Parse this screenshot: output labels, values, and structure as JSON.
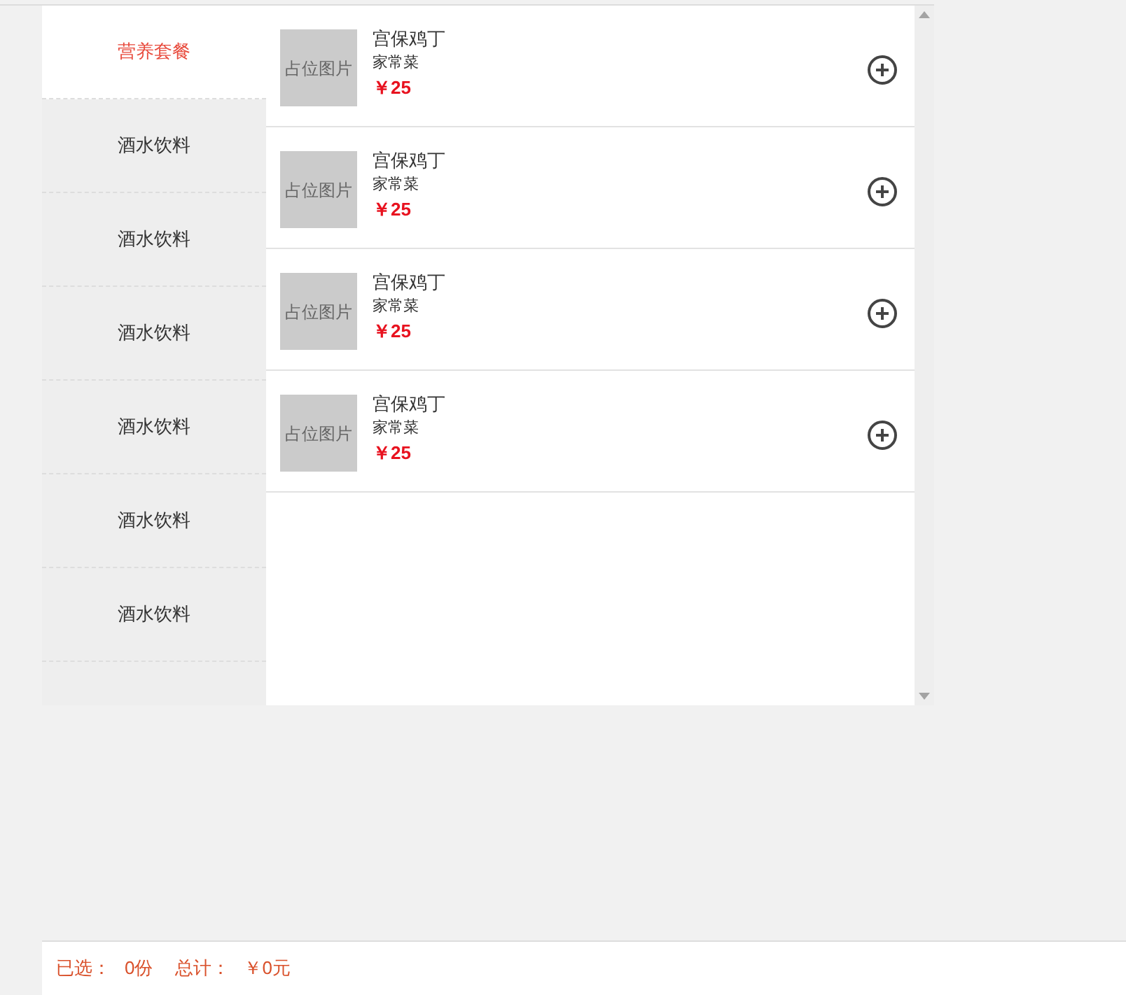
{
  "categories": [
    {
      "label": "营养套餐",
      "selected": true
    },
    {
      "label": "酒水饮料",
      "selected": false
    },
    {
      "label": "酒水饮料",
      "selected": false
    },
    {
      "label": "酒水饮料",
      "selected": false
    },
    {
      "label": "酒水饮料",
      "selected": false
    },
    {
      "label": "酒水饮料",
      "selected": false
    },
    {
      "label": "酒水饮料",
      "selected": false
    }
  ],
  "dishes": [
    {
      "image_label": "占位图片",
      "name": "宫保鸡丁",
      "category": "家常菜",
      "price": "￥25"
    },
    {
      "image_label": "占位图片",
      "name": "宫保鸡丁",
      "category": "家常菜",
      "price": "￥25"
    },
    {
      "image_label": "占位图片",
      "name": "宫保鸡丁",
      "category": "家常菜",
      "price": "￥25"
    },
    {
      "image_label": "占位图片",
      "name": "宫保鸡丁",
      "category": "家常菜",
      "price": "￥25"
    }
  ],
  "footer": {
    "selected_label": "已选：",
    "selected_count": "0份",
    "total_label": "总计：",
    "total_value": "￥0元"
  }
}
